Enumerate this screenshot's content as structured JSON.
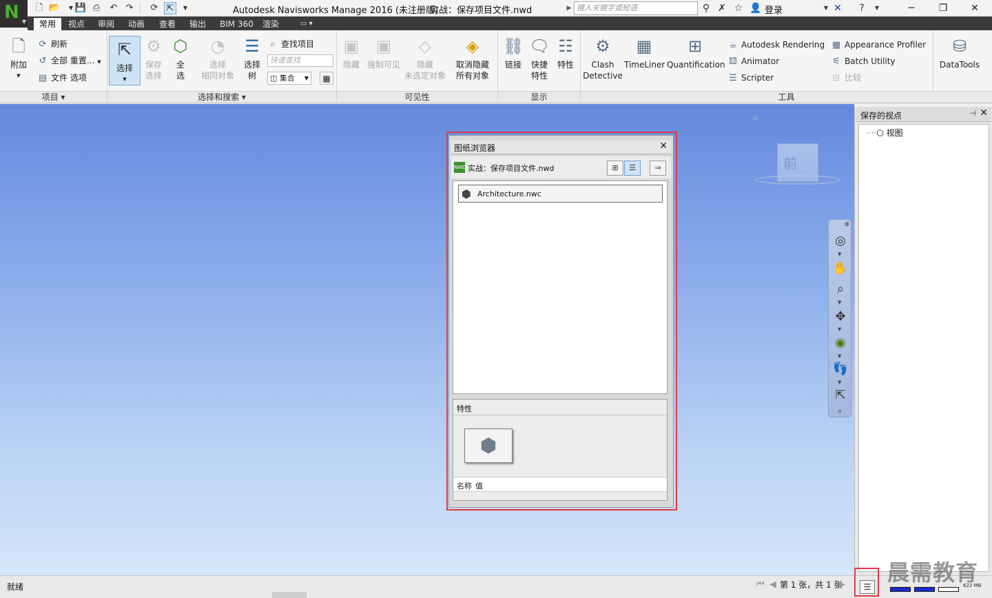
{
  "app": {
    "title": "Autodesk Navisworks Manage 2016 (未注册版)",
    "document": "实战：保存项目文件.nwd",
    "logo_letter": "N"
  },
  "titlebar": {
    "search_placeholder": "键入关键字或短语",
    "login_label": "登录"
  },
  "tabs": [
    "常用",
    "视点",
    "审阅",
    "动画",
    "查看",
    "输出",
    "BIM 360",
    "渲染"
  ],
  "active_tab": "常用",
  "ribbon": {
    "project": {
      "append": "附加",
      "refresh": "刷新",
      "reset_all": "全部 重置...",
      "file_options": "文件 选项",
      "panel": "项目"
    },
    "select_search": {
      "select": "选择",
      "save_selection": [
        "保存",
        "选择"
      ],
      "select_all": [
        "全",
        "选"
      ],
      "select_same": [
        "选择",
        "相同对象"
      ],
      "selection_tree": [
        "选择",
        "树"
      ],
      "find_items": "查找项目",
      "quick_find_placeholder": "快速查找",
      "sets": "集合",
      "panel": "选择和搜索"
    },
    "visibility": {
      "hide": "隐藏",
      "require": "强制可见",
      "hide_unselected": [
        "隐藏",
        "未选定对象"
      ],
      "unhide_all": [
        "取消隐藏",
        "所有对象"
      ],
      "panel": "可见性"
    },
    "display": {
      "links": "链接",
      "quick_properties": [
        "快捷",
        "特性"
      ],
      "properties": "特性",
      "panel": "显示"
    },
    "tools": {
      "clash_detective": [
        "Clash",
        "Detective"
      ],
      "timeliner": "TimeLiner",
      "quantification": "Quantification",
      "autodesk_rendering": "Autodesk Rendering",
      "animator": "Animator",
      "scripter": "Scripter",
      "appearance_profiler": "Appearance Profiler",
      "batch_utility": "Batch Utility",
      "compare": "比较",
      "datatools": "DataTools",
      "panel": "工具"
    }
  },
  "viewcube": {
    "face": "前"
  },
  "sheet_browser": {
    "title": "图纸浏览器",
    "document": "实战：保存项目文件.nwd",
    "doc_icon_text": "NWD",
    "items": [
      "Architecture.nwc"
    ],
    "properties_title": "特性",
    "prop_name_col": "名称",
    "prop_value_col": "值"
  },
  "saved_viewpoints": {
    "title": "保存的视点",
    "nodes": [
      "视图"
    ]
  },
  "statusbar": {
    "status": "就绪",
    "page_info": "第 1 张，共 1 张",
    "memory": "622 MB"
  },
  "watermark": "晨需教育",
  "colors": {
    "highlight": "#e23a46",
    "viewport_top": "#6489dd",
    "viewport_bottom": "#d6e6fa",
    "meter": "#1b2bd6"
  }
}
